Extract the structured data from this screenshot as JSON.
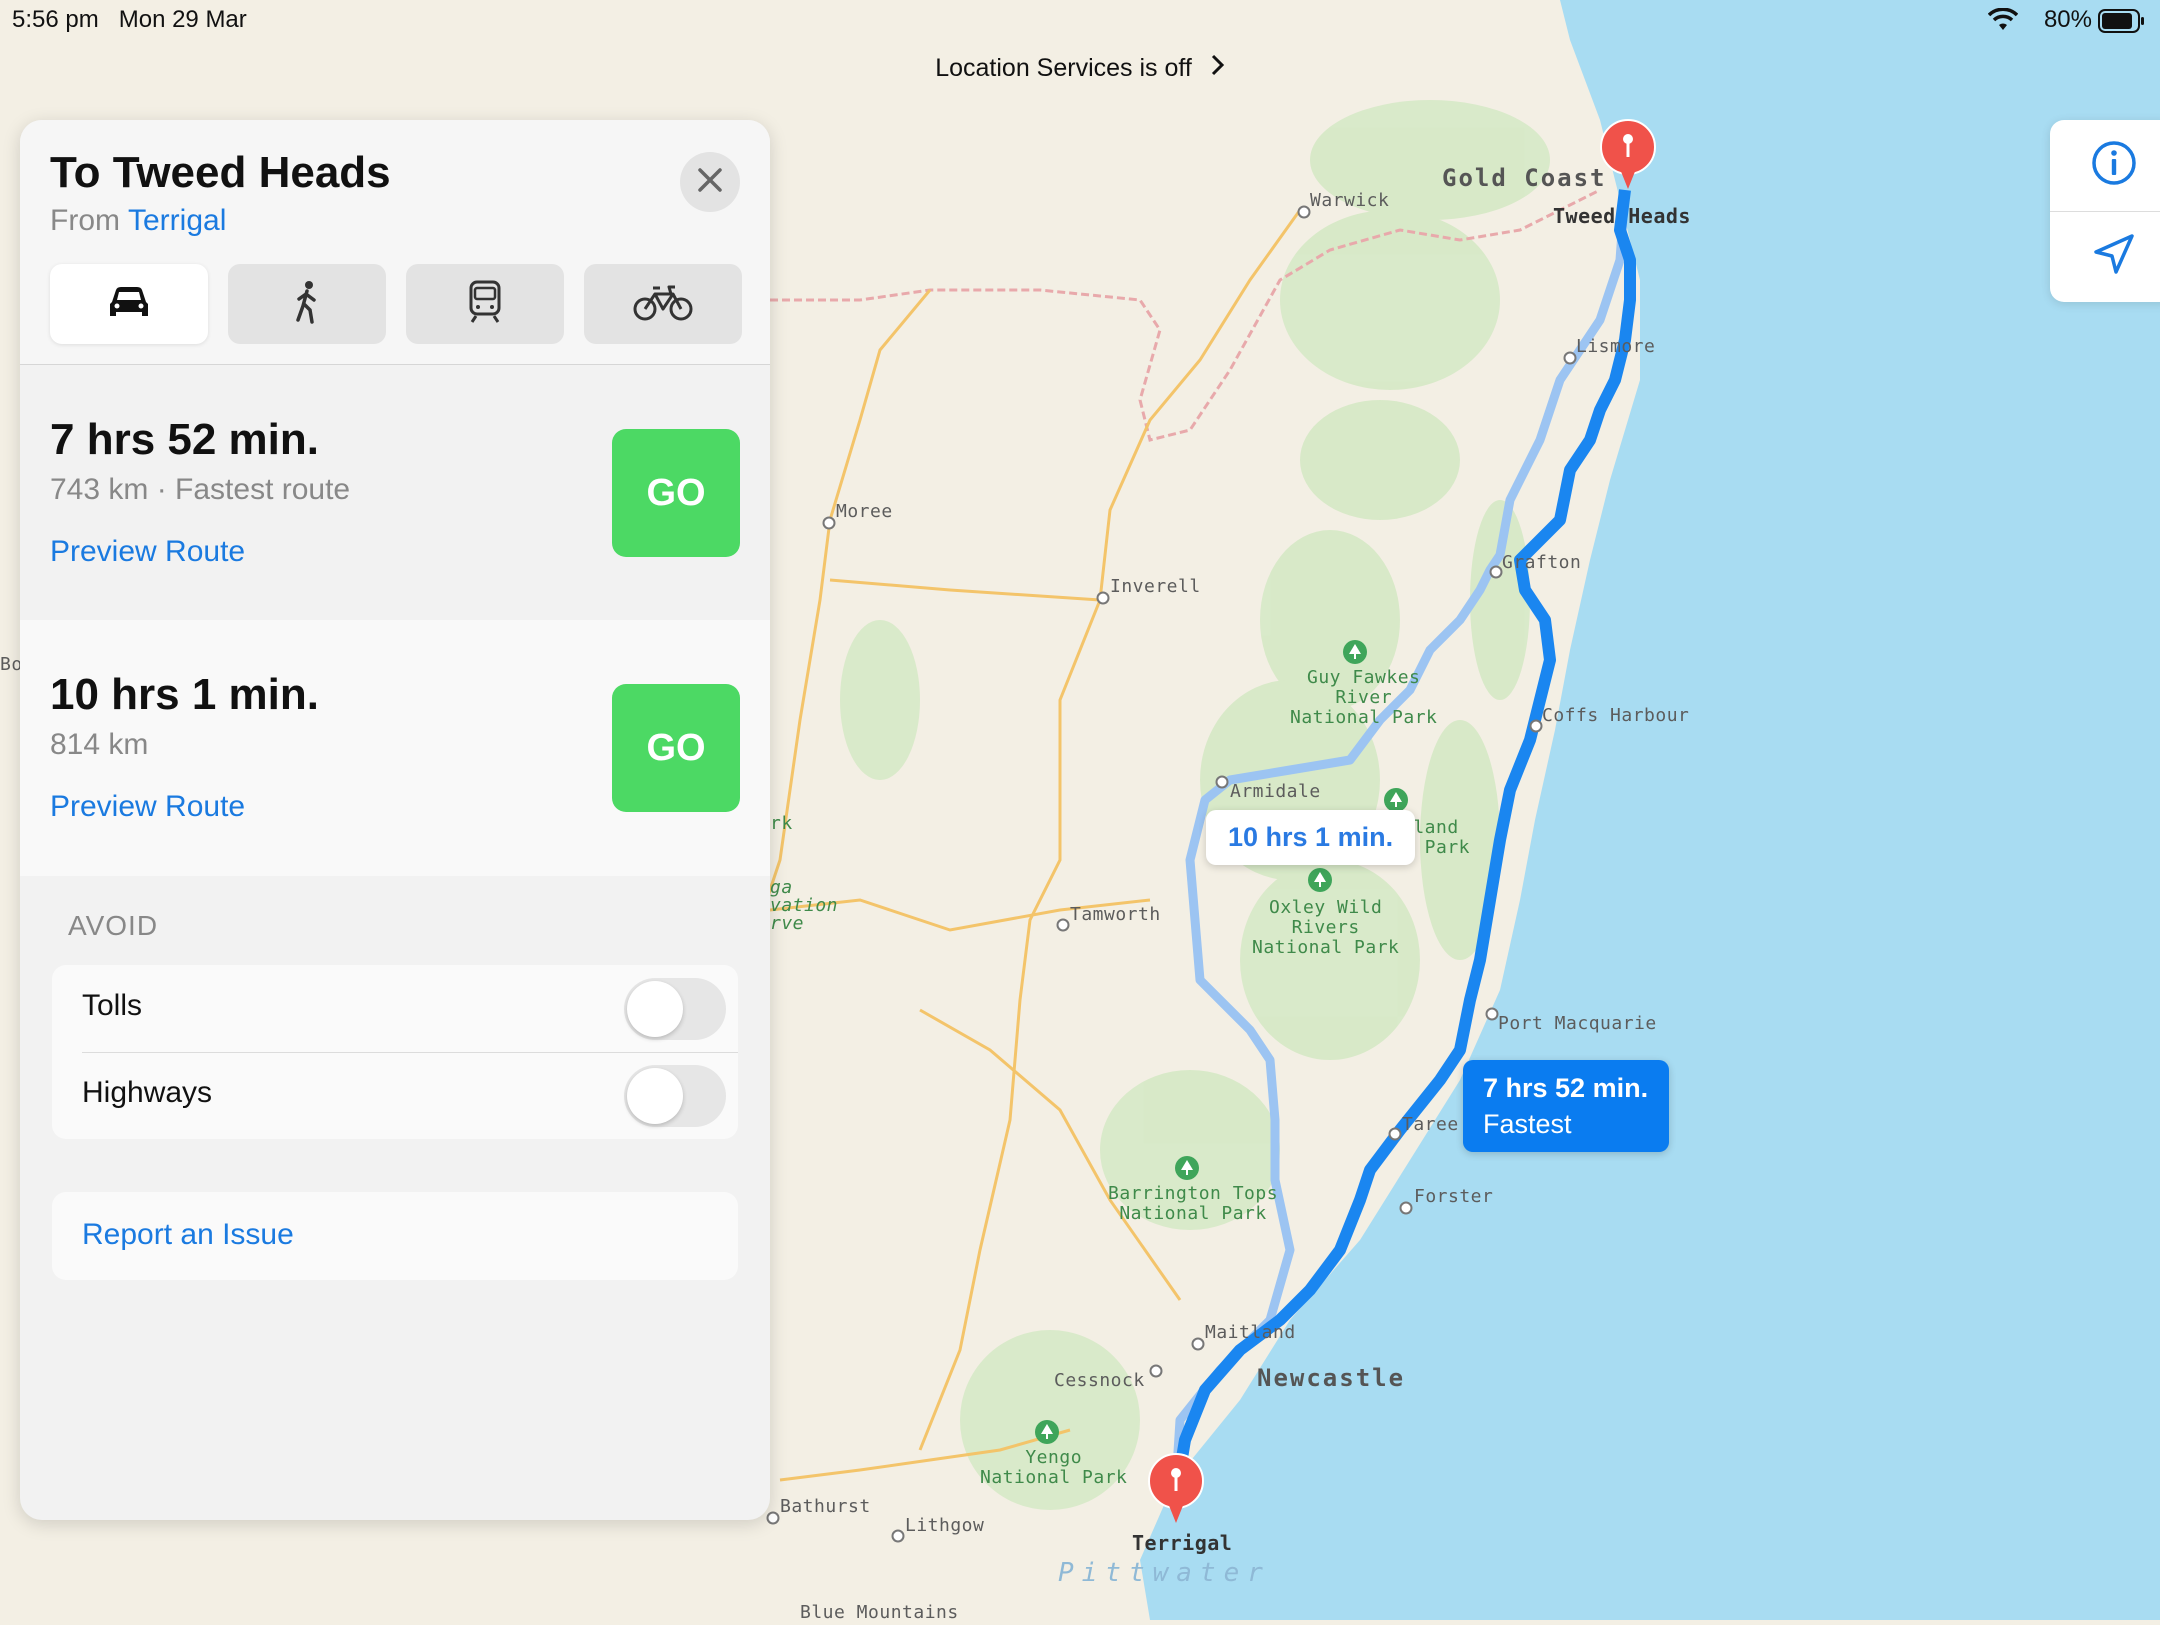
{
  "status_bar": {
    "time": "5:56 pm   Mon 29 Mar",
    "battery": "80%"
  },
  "location_banner": {
    "text": "Location Services is off"
  },
  "panel": {
    "title": "To Tweed Heads",
    "from_label": "From",
    "origin": "Terrigal",
    "modes": [
      {
        "name": "car-icon",
        "active": true
      },
      {
        "name": "walk-icon",
        "active": false
      },
      {
        "name": "transit-icon",
        "active": false
      },
      {
        "name": "bicycle-icon",
        "active": false
      }
    ],
    "routes": [
      {
        "time": "7 hrs 52 min.",
        "details": "743 km · Fastest route",
        "preview": "Preview Route",
        "go": "GO"
      },
      {
        "time": "10 hrs 1 min.",
        "details": "814 km",
        "preview": "Preview Route",
        "go": "GO"
      }
    ],
    "avoid": {
      "heading": "AVOID",
      "options": [
        {
          "label": "Tolls",
          "on": false
        },
        {
          "label": "Highways",
          "on": false
        }
      ]
    },
    "report": "Report an Issue"
  },
  "map": {
    "callouts": {
      "alternate": "10 hrs 1 min.",
      "fastest_time": "7 hrs 52 min.",
      "fastest_label": "Fastest"
    },
    "places": {
      "gold_coast": "Gold Coast",
      "tweed_heads": "Tweed Heads",
      "warwick": "Warwick",
      "lismore": "Lismore",
      "moree": "Moree",
      "inverell": "Inverell",
      "grafton": "Grafton",
      "coffs_harbour": "Coffs Harbour",
      "armidale": "Armidale",
      "tamworth": "Tamworth",
      "port_macquarie": "Port Macquarie",
      "taree": "Taree",
      "forster": "Forster",
      "maitland": "Maitland",
      "newcastle": "Newcastle",
      "cessnock": "Cessnock",
      "bathurst": "Bathurst",
      "lithgow": "Lithgow",
      "terrigal": "Terrigal",
      "blue_mountains": "Blue Mountains",
      "pittwater": "Pittwater"
    },
    "parks": {
      "guy_fawkes": "Guy Fawkes\nRiver\nNational Park",
      "new_england": "gland\nl Park",
      "oxley": "Oxley Wild\nRivers\nNational Park",
      "barrington": "Barrington Tops\nNational Park",
      "yengo": "Yengo\nNational Park"
    },
    "edge_fragments": {
      "left_bo": "Bo",
      "rk": "rk",
      "ga": "ga",
      "vation": "vation",
      "rve": "rve"
    },
    "colors": {
      "route_primary": "#1a86f0",
      "route_alternate": "#9cc4f2",
      "sea": "#a8dcf2",
      "land": "#f3efe4",
      "go_button": "#4cd964",
      "link": "#1a7ae0",
      "pin": "#f0524a"
    }
  }
}
